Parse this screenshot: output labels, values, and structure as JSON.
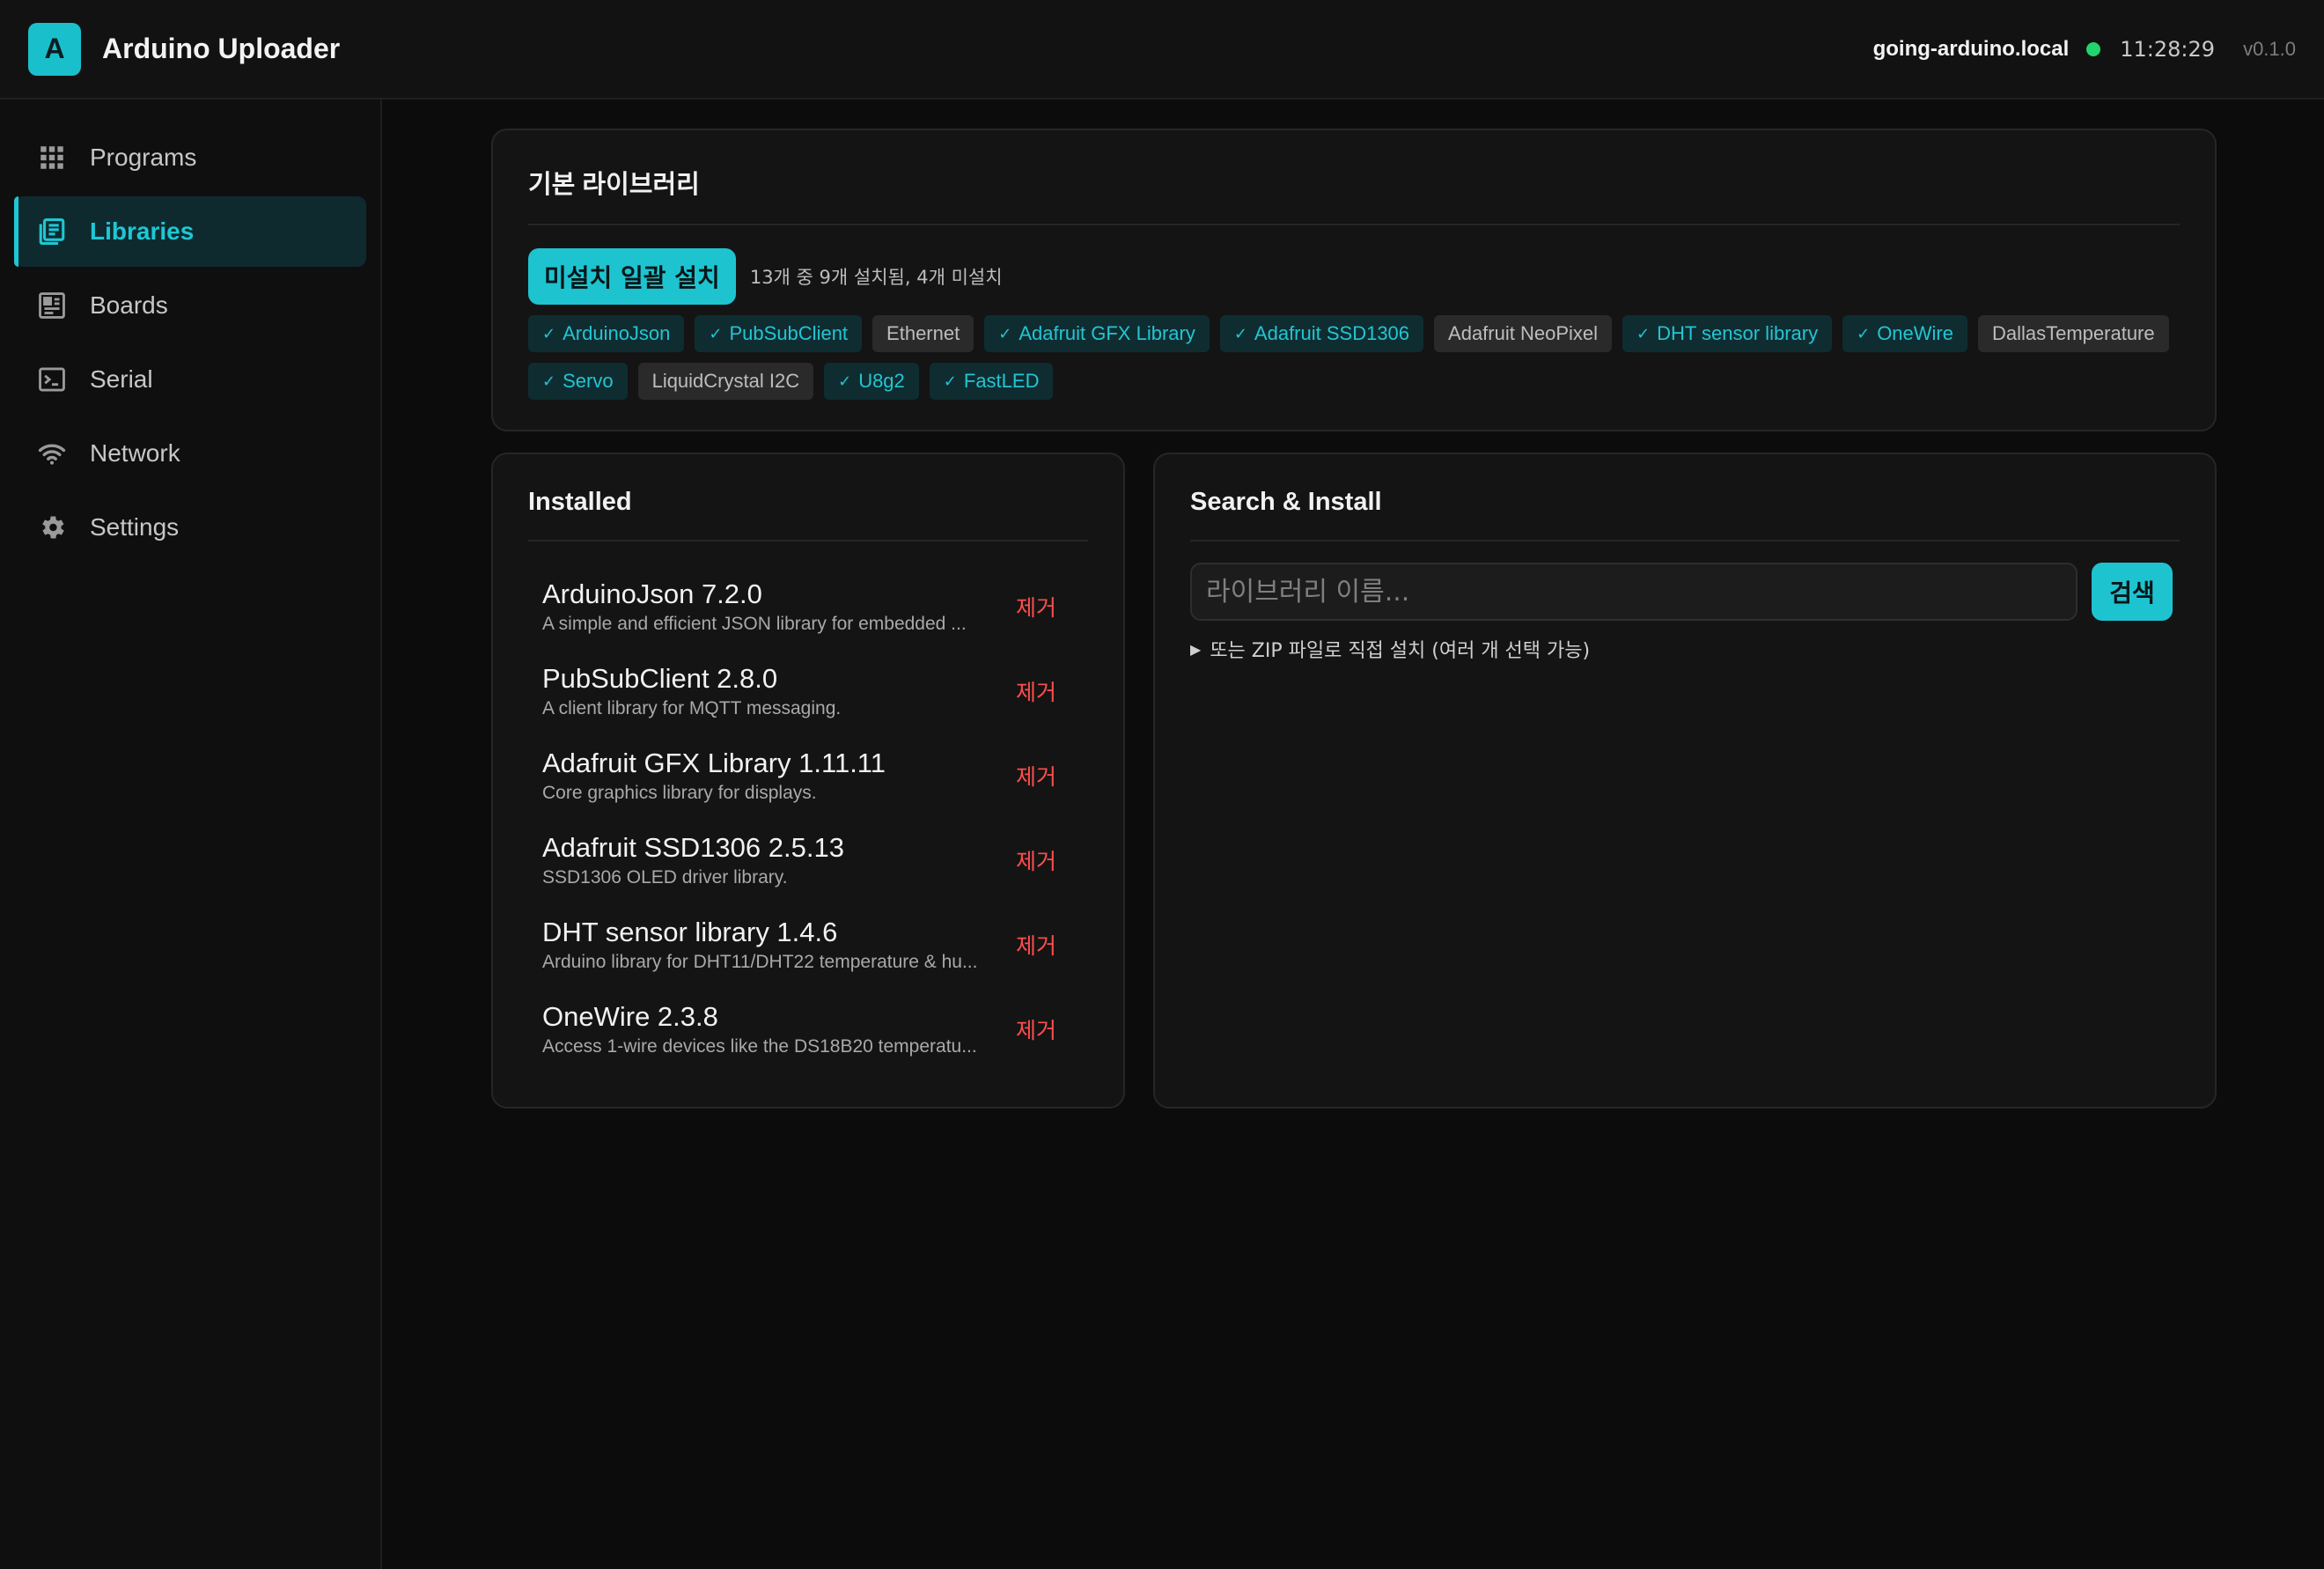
{
  "header": {
    "logo_letter": "A",
    "title": "Arduino Uploader",
    "host": "going-arduino.local",
    "clock": "11:28:29",
    "version": "v0.1.0",
    "status_color": "#22d36e"
  },
  "sidebar": {
    "items": [
      {
        "label": "Programs",
        "icon": "grid-icon",
        "active": false
      },
      {
        "label": "Libraries",
        "icon": "book-icon",
        "active": true
      },
      {
        "label": "Boards",
        "icon": "board-icon",
        "active": false
      },
      {
        "label": "Serial",
        "icon": "terminal-icon",
        "active": false
      },
      {
        "label": "Network",
        "icon": "wifi-icon",
        "active": false
      },
      {
        "label": "Settings",
        "icon": "gear-icon",
        "active": false
      }
    ]
  },
  "basic": {
    "title": "기본 라이브러리",
    "bulk_button": "미설치 일괄 설치",
    "status": "13개 중 9개 설치됨, 4개 미설치",
    "tags": [
      {
        "label": "ArduinoJson",
        "installed": true
      },
      {
        "label": "PubSubClient",
        "installed": true
      },
      {
        "label": "Ethernet",
        "installed": false
      },
      {
        "label": "Adafruit GFX Library",
        "installed": true
      },
      {
        "label": "Adafruit SSD1306",
        "installed": true
      },
      {
        "label": "Adafruit NeoPixel",
        "installed": false
      },
      {
        "label": "DHT sensor library",
        "installed": true
      },
      {
        "label": "OneWire",
        "installed": true
      },
      {
        "label": "DallasTemperature",
        "installed": false
      },
      {
        "label": "Servo",
        "installed": true
      },
      {
        "label": "LiquidCrystal I2C",
        "installed": false
      },
      {
        "label": "U8g2",
        "installed": true
      },
      {
        "label": "FastLED",
        "installed": true
      }
    ]
  },
  "installed": {
    "title": "Installed",
    "remove_label": "제거",
    "items": [
      {
        "name": "ArduinoJson 7.2.0",
        "desc": "A simple and efficient JSON library for embedded ..."
      },
      {
        "name": "PubSubClient 2.8.0",
        "desc": "A client library for MQTT messaging."
      },
      {
        "name": "Adafruit GFX Library 1.11.11",
        "desc": "Core graphics library for displays."
      },
      {
        "name": "Adafruit SSD1306 2.5.13",
        "desc": "SSD1306 OLED driver library."
      },
      {
        "name": "DHT sensor library 1.4.6",
        "desc": "Arduino library for DHT11/DHT22 temperature & hu..."
      },
      {
        "name": "OneWire 2.3.8",
        "desc": "Access 1-wire devices like the DS18B20 temperatu..."
      }
    ]
  },
  "search": {
    "title": "Search & Install",
    "placeholder": "라이브러리 이름...",
    "button": "검색",
    "zip_toggle": "또는 ZIP 파일로 직접 설치 (여러 개 선택 가능)"
  },
  "colors": {
    "accent": "#1ec3d0",
    "remove": "#ff4d4d",
    "background": "#0c0c0c"
  }
}
